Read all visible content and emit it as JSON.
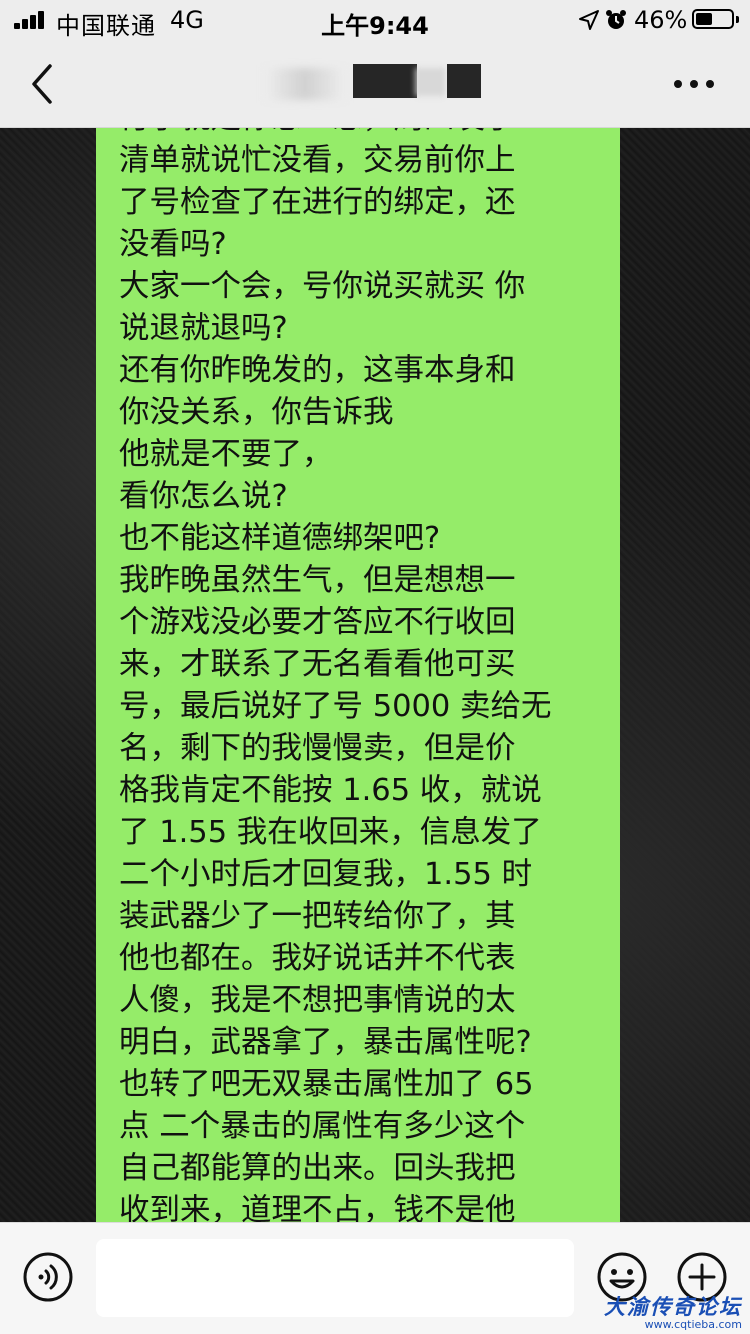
{
  "status_bar": {
    "carrier": "中国联通",
    "network": "4G",
    "time": "上午9:44",
    "battery_percent_text": "46%",
    "battery_level": 0.46
  },
  "nav_bar": {
    "title_obscured": true
  },
  "message": {
    "lines": [
      "付了就是你想一想，周四发了",
      "清单就说忙没看，交易前你上",
      "了号检查了在进行的绑定，还",
      "没看吗?",
      "大家一个会，号你说买就买 你",
      "说退就退吗?",
      "还有你昨晚发的，这事本身和",
      "你没关系，你告诉我",
      "他就是不要了，",
      "看你怎么说?",
      "也不能这样道德绑架吧?",
      "我昨晚虽然生气，但是想想一",
      "个游戏没必要才答应不行收回",
      "来，才联系了无名看看他可买",
      "号，最后说好了号 5000 卖给无",
      "名，剩下的我慢慢卖，但是价",
      "格我肯定不能按 1.65 收，就说",
      "了 1.55 我在收回来，信息发了",
      "二个小时后才回复我，1.55 时",
      "装武器少了一把转给你了，其",
      "他也都在。我好说话并不代表",
      "人傻，我是不想把事情说的太",
      "明白，武器拿了，暴击属性呢?",
      "也转了吧无双暴击属性加了 65",
      "点 二个暴击的属性有多少这个",
      "自己都能算的出来。回头我把",
      "收到来，道理不占，钱不是他"
    ]
  },
  "input_bar": {
    "text_value": ""
  },
  "watermark": {
    "main": "大渝传奇论坛",
    "url": "www.cqtieba.com"
  },
  "colors": {
    "bubble": "#95ec69",
    "bar_bg": "#ededed",
    "chat_bg": "#1c1c1c"
  }
}
